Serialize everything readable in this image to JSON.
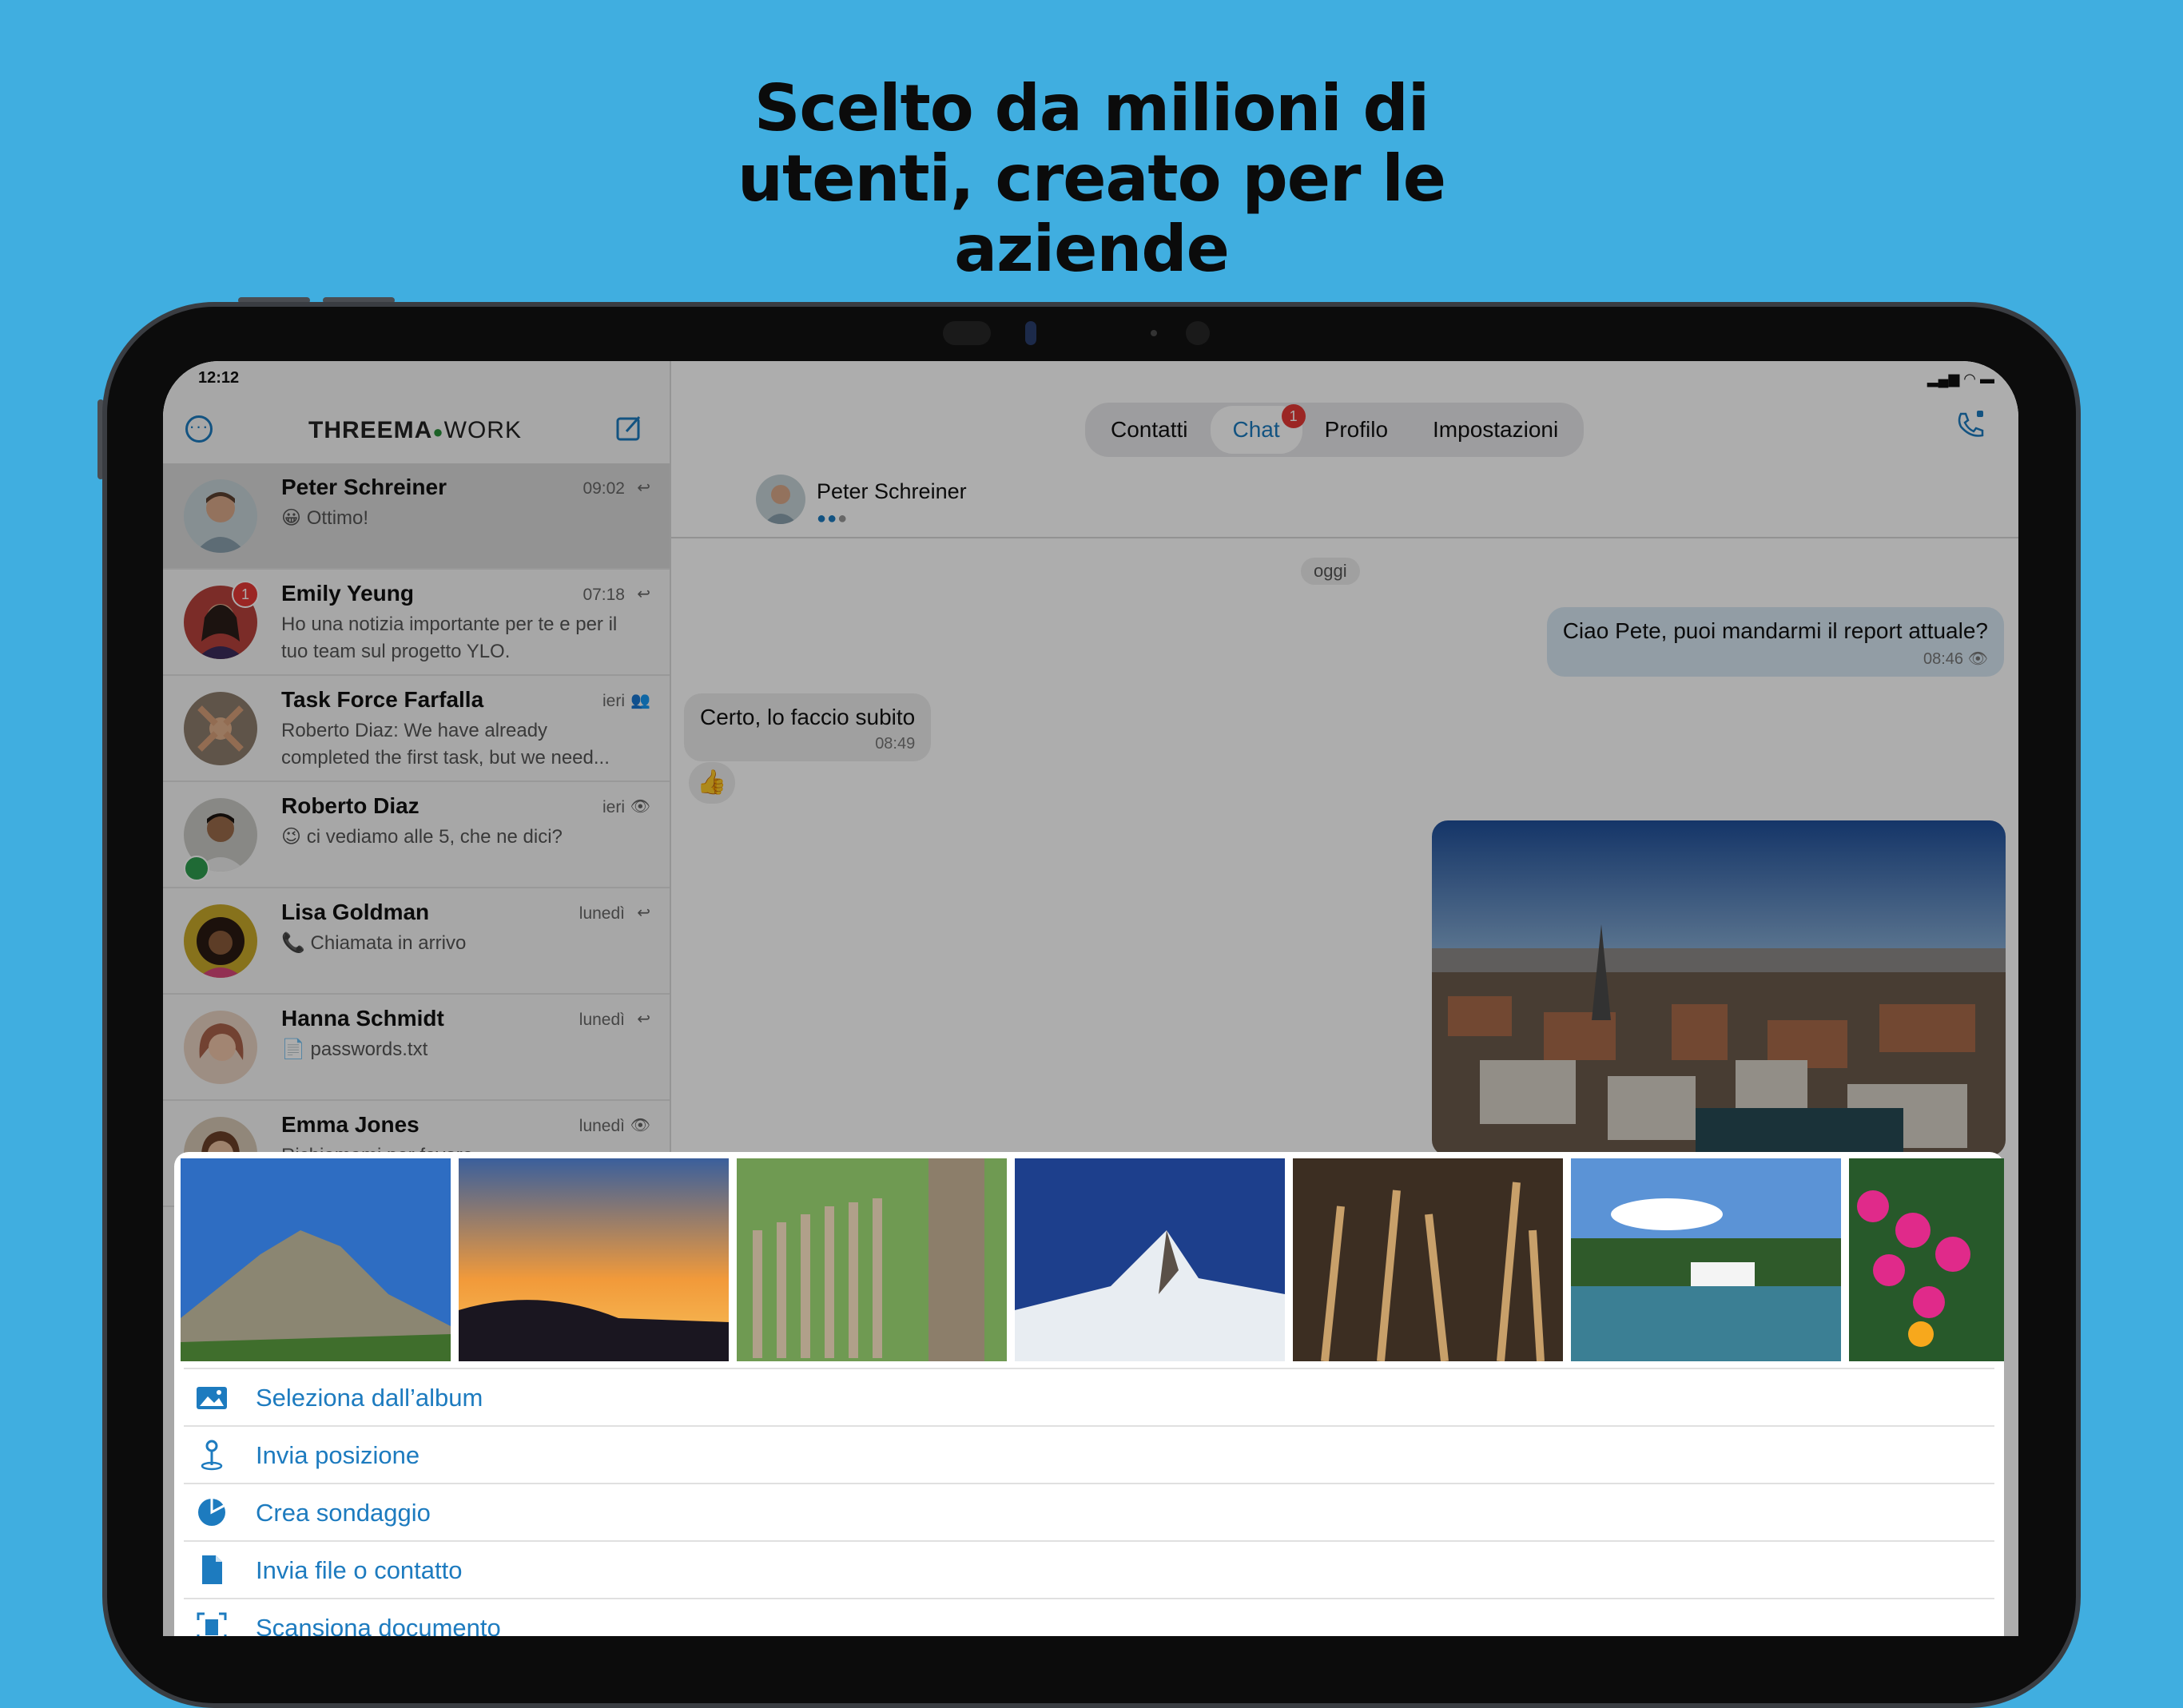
{
  "headline": [
    "Scelto da milioni di",
    "utenti, creato per le",
    "aziende"
  ],
  "status": {
    "time": "12:12"
  },
  "sidebar": {
    "logo_left": "THREEMA",
    "logo_right": "WORK",
    "chats": [
      {
        "name": "Peter Schreiner",
        "time": "09:02",
        "preview": "😀 Ottimo!",
        "status_icon": "reply-icon",
        "selected": true
      },
      {
        "name": "Emily Yeung",
        "time": "07:18",
        "preview": "Ho una notizia importante per te e per il tuo team sul progetto YLO.",
        "status_icon": "reply-icon",
        "badge": "1"
      },
      {
        "name": "Task Force Farfalla",
        "time": "ieri",
        "preview": "Roberto Diaz: We have already completed the first task, but we need...",
        "status_icon": "group-icon"
      },
      {
        "name": "Roberto Diaz",
        "time": "ieri",
        "preview": "😉 ci vediamo alle 5, che ne dici?",
        "status_icon": "eye-icon"
      },
      {
        "name": "Lisa Goldman",
        "time": "lunedì",
        "preview": "📞 Chiamata in arrivo",
        "status_icon": "reply-icon"
      },
      {
        "name": "Hanna Schmidt",
        "time": "lunedì",
        "preview": "📄 passwords.txt",
        "status_icon": "reply-icon"
      },
      {
        "name": "Emma Jones",
        "time": "lunedì",
        "preview": "Richiamami per favore",
        "status_icon": "eye-icon"
      }
    ]
  },
  "tabs": [
    {
      "label": "Contatti"
    },
    {
      "label": "Chat",
      "badge": "1",
      "active": true
    },
    {
      "label": "Profilo"
    },
    {
      "label": "Impostazioni"
    }
  ],
  "conversation": {
    "contact_name": "Peter Schreiner",
    "date_chip": "oggi",
    "outgoing": {
      "text": "Ciao Pete, puoi mandarmi il report attuale?",
      "time": "08:46"
    },
    "incoming": {
      "text": "Certo, lo faccio subito",
      "time": "08:49"
    },
    "reaction": "👍"
  },
  "attach_sheet": {
    "actions": [
      {
        "label": "Seleziona dall’album",
        "icon": "photo-album-icon"
      },
      {
        "label": "Invia posizione",
        "icon": "location-pin-icon"
      },
      {
        "label": "Crea sondaggio",
        "icon": "poll-icon"
      },
      {
        "label": "Invia file o contatto",
        "icon": "file-icon"
      },
      {
        "label": "Scansiona documento",
        "icon": "scan-document-icon"
      }
    ]
  },
  "colors": {
    "background": "#40aee0",
    "accent": "#1d7bbf",
    "badge": "#e53935"
  }
}
